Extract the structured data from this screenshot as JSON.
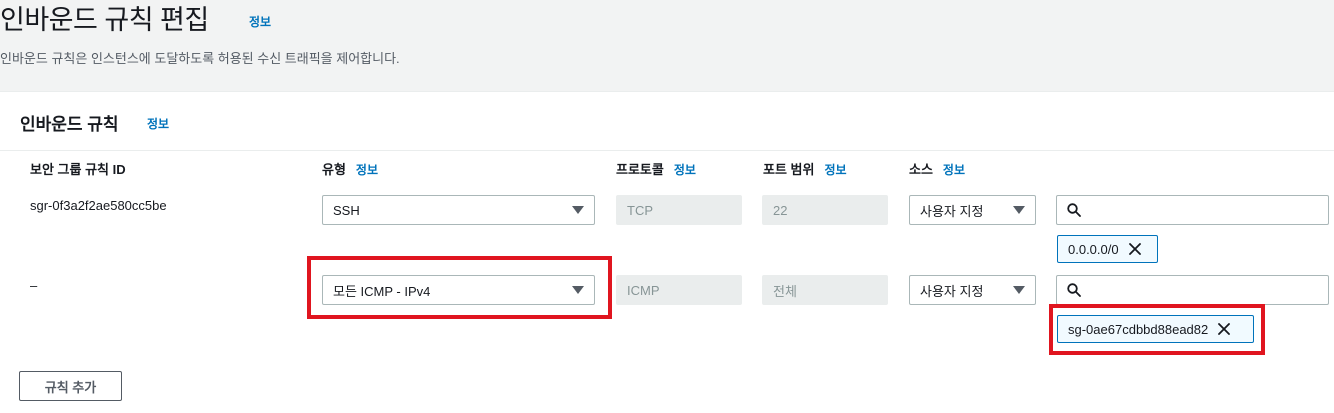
{
  "page": {
    "title": "인바운드 규칙 편집",
    "info": "정보",
    "description": "인바운드 규칙은 인스턴스에 도달하도록 허용된 수신 트래픽을 제어합니다."
  },
  "panel": {
    "title": "인바운드 규칙",
    "info": "정보"
  },
  "columns": {
    "rule_id": "보안 그룹 규칙 ID",
    "type": "유형",
    "type_info": "정보",
    "protocol": "프로토콜",
    "protocol_info": "정보",
    "port_range": "포트 범위",
    "port_range_info": "정보",
    "source": "소스",
    "source_info": "정보"
  },
  "rules": [
    {
      "id": "sgr-0f3a2f2ae580cc5be",
      "type": "SSH",
      "protocol": "TCP",
      "port_range": "22",
      "source_type": "사용자 지정",
      "source_token": "0.0.0.0/0"
    },
    {
      "id": "–",
      "type": "모든 ICMP - IPv4",
      "protocol": "ICMP",
      "port_range": "전체",
      "source_type": "사용자 지정",
      "source_token": "sg-0ae67cdbbd88ead82"
    }
  ],
  "add_rule_label": "규칙 추가",
  "colors": {
    "link": "#0073bb",
    "highlight": "#e0151f",
    "token_border": "#0073bb"
  }
}
